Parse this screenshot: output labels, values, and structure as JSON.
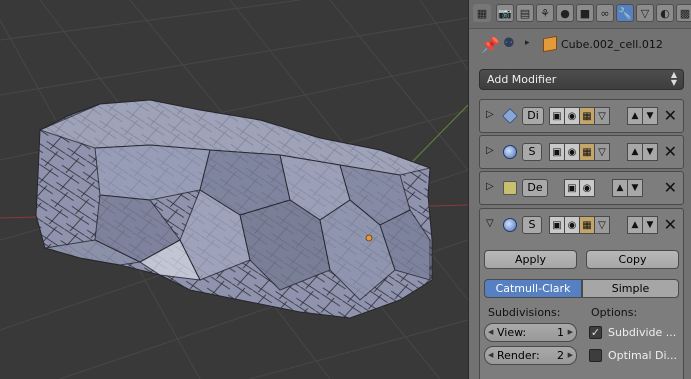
{
  "properties_header": {
    "context_icons": [
      "render-icon",
      "render-layers-icon",
      "scene-icon",
      "world-icon",
      "object-icon",
      "constraints-icon",
      "modifiers-icon",
      "data-icon",
      "material-icon",
      "texture-icon"
    ],
    "active_icon": "modifiers-icon"
  },
  "object": {
    "name": "Cube.002_cell.012"
  },
  "add_modifier": {
    "label": "Add Modifier"
  },
  "modifiers": [
    {
      "type_icon": "decimate-icon",
      "name": "Di",
      "expanded": false
    },
    {
      "type_icon": "subsurf-icon",
      "name": "S",
      "expanded": false
    },
    {
      "type_icon": "displace-icon",
      "name": "De",
      "expanded": false
    },
    {
      "type_icon": "subsurf-icon",
      "name": "S",
      "expanded": true
    }
  ],
  "subsurf": {
    "apply_label": "Apply",
    "copy_label": "Copy",
    "mode_catmull": "Catmull-Clark",
    "mode_simple": "Simple",
    "subdivisions_label": "Subdivisions:",
    "options_label": "Options:",
    "view_label": "View:",
    "view_value": "1",
    "render_label": "Render:",
    "render_value": "2",
    "subdivide_uvs_label": "Subdivide ...",
    "subdivide_uvs_checked": true,
    "optimal_display_label": "Optimal Di...",
    "optimal_display_checked": false
  },
  "colors": {
    "accent": "#5680c2",
    "panel_bg": "#727272",
    "viewport_bg": "#393939",
    "mesh_face": "#8a8ea8",
    "object_origin": "#e29a3b"
  }
}
